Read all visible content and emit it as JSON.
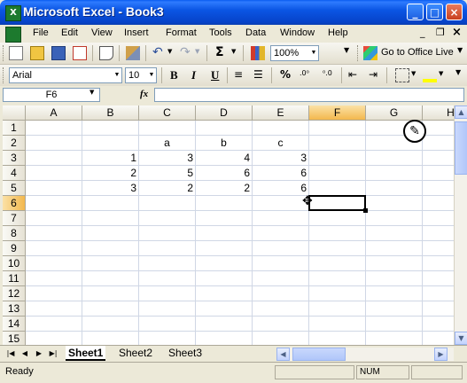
{
  "window": {
    "title": "Microsoft Excel - Book3",
    "app_icon_text": "X"
  },
  "caption_buttons": {
    "minimize": "_",
    "maximize": "□",
    "close": "×"
  },
  "menus": [
    "File",
    "Edit",
    "View",
    "Insert",
    "Format",
    "Tools",
    "Data",
    "Window",
    "Help"
  ],
  "menu_right_controls": {
    "minimize": "_",
    "restore": "❐",
    "close": "×"
  },
  "toolbar_standard": {
    "zoom": "100%",
    "office_live": "Go to Office Live",
    "sigma": "Σ"
  },
  "toolbar_format": {
    "font": "Arial",
    "size": "10",
    "bold": "B",
    "italic": "I",
    "underline": "U",
    "percent": "%"
  },
  "formula_bar": {
    "name_box": "F6",
    "fx": "fx",
    "formula": ""
  },
  "columns": [
    "A",
    "B",
    "C",
    "D",
    "E",
    "F",
    "G",
    "H"
  ],
  "rows": [
    "1",
    "2",
    "3",
    "4",
    "5",
    "6",
    "7",
    "8",
    "9",
    "10",
    "11",
    "12",
    "13",
    "14",
    "15"
  ],
  "active_cell": {
    "col": "F",
    "row": "6"
  },
  "cells": {
    "C2": "a",
    "D2": "b",
    "E2": "c",
    "B3": "1",
    "C3": "3",
    "D3": "4",
    "E3": "3",
    "B4": "2",
    "C4": "5",
    "D4": "6",
    "E4": "6",
    "B5": "3",
    "C5": "2",
    "D5": "2",
    "E5": "6"
  },
  "sheets": [
    "Sheet1",
    "Sheet2",
    "Sheet3"
  ],
  "active_sheet": "Sheet1",
  "status": {
    "text": "Ready",
    "num": "NUM"
  },
  "colors": {
    "title_bar": "#0a5cf0",
    "active_header": "#f3b84d",
    "gridline": "#d0d7e5"
  }
}
